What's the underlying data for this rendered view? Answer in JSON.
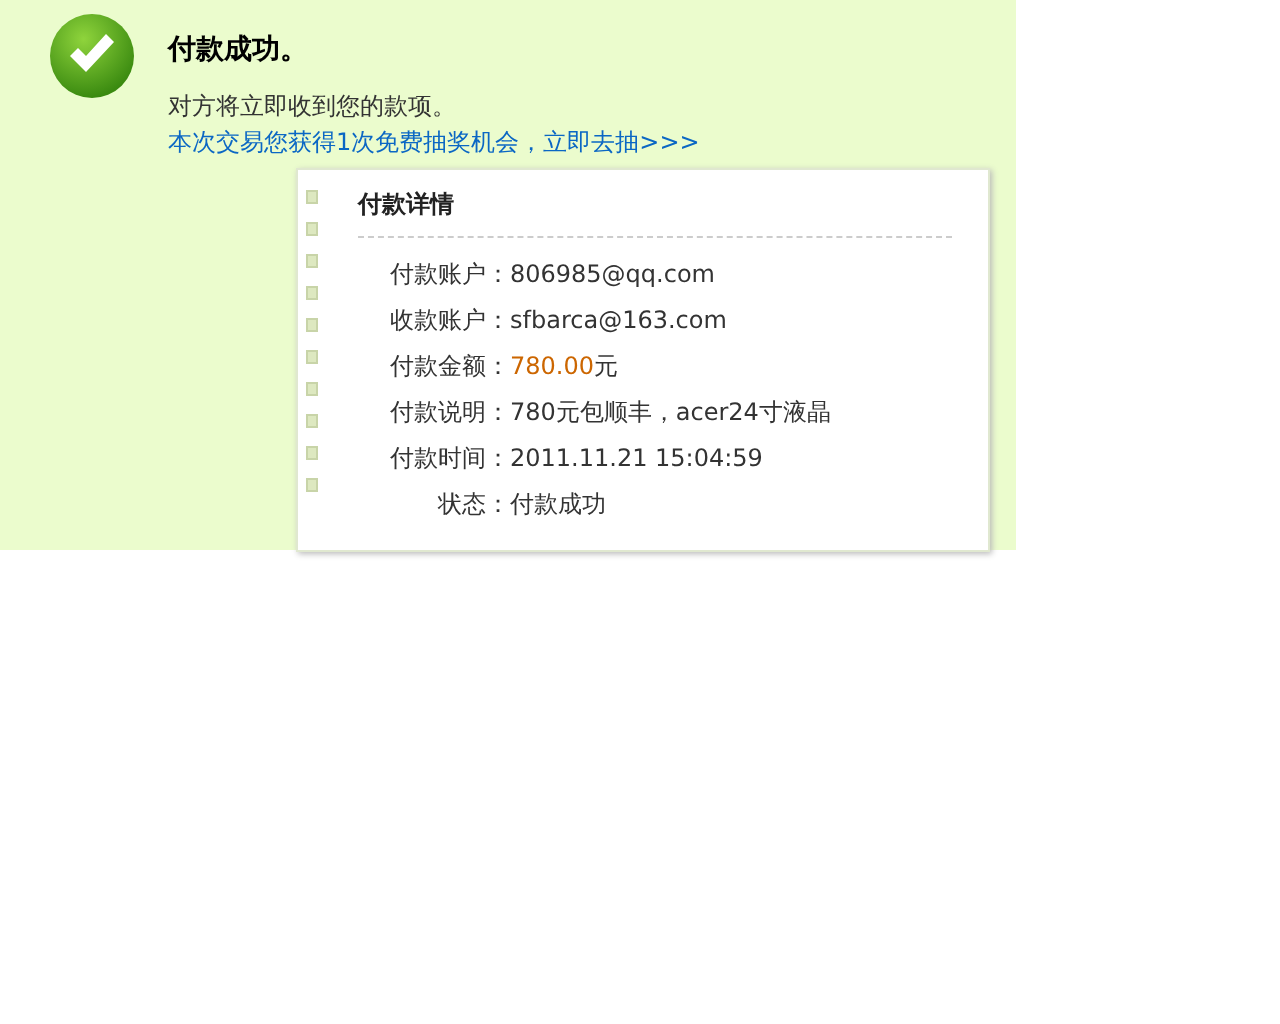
{
  "result": {
    "title": "付款成功。",
    "message": "对方将立即收到您的款项。",
    "promo_link": "本次交易您获得1次免费抽奖机会，立即去抽>>>"
  },
  "details": {
    "title": "付款详情",
    "rows": [
      {
        "kind": "text",
        "label": "付款账户：",
        "value": "806985@qq.com"
      },
      {
        "kind": "text",
        "label": "收款账户：",
        "value": "sfbarca@163.com"
      },
      {
        "kind": "amount",
        "label": "付款金额：",
        "value": "780.00",
        "unit": "元"
      },
      {
        "kind": "text",
        "label": "付款说明：",
        "value": "780元包顺丰，acer24寸液晶"
      },
      {
        "kind": "text",
        "label": "付款时间：",
        "value": "2011.11.21 15:04:59"
      },
      {
        "kind": "text",
        "label": "状态：",
        "value": "付款成功"
      }
    ]
  }
}
